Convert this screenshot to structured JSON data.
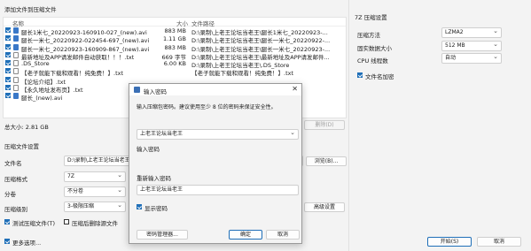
{
  "add_files": {
    "title": "添加文件到压缩文件",
    "columns": {
      "name": "名称",
      "size": "大小",
      "path": "文件路径"
    },
    "files": [
      {
        "name": "腿长1米七_20220923-160910-027_(new).avi",
        "size": "883 MB",
        "path": "D:\\录制\\上老王论坛当老王\\腿长1米七_20220923-...",
        "type": "avi"
      },
      {
        "name": "腿长一米七_20220922-022454-697_(new).avi",
        "size": "1.11 GB",
        "path": "D:\\录制\\上老王论坛当老王\\腿长一米七_20220922-...",
        "type": "avi"
      },
      {
        "name": "腿长一米七_20220923-160909-867_(new).avi",
        "size": "883 MB",
        "path": "D:\\录制\\上老王论坛当老王\\腿长一米七_20220923-...",
        "type": "avi"
      },
      {
        "name": "最新地址及APP请发邮件自动获取！！！.txt",
        "size": "669 字节",
        "path": "D:\\录制\\上老王论坛当老王\\最新地址及APP请发邮件...",
        "type": "txt"
      },
      {
        "name": ".DS_Store",
        "size": "6.00 KB",
        "path": "D:\\录制\\上老王论坛当老王\\.DS_Store",
        "type": "txt"
      },
      {
        "name": "【老子就能下载和观看！纯免费！】.txt",
        "size": "",
        "path": "【老子就能下载和观看！纯免费！】.txt",
        "type": "txt"
      },
      {
        "name": "【论坛介绍】.txt",
        "size": "",
        "path": "",
        "type": "txt"
      },
      {
        "name": "【永久地址发布页】.txt",
        "size": "",
        "path": "",
        "type": "txt"
      },
      {
        "name": "腿长_(new).avi",
        "size": "",
        "path": "",
        "type": "avi"
      }
    ],
    "total_label": "总大小: 2.81 GB",
    "delete_button": "删除(D)"
  },
  "settings": {
    "title": "压缩文件设置",
    "filename_label": "文件名",
    "filename_value": "D:\\录制\\上老王论坛当老王\\上老王论坛当老王.7z",
    "browse_button": "浏览(B)...",
    "format_label": "压缩格式",
    "format_value": "7Z",
    "split_label": "分卷",
    "split_value": "不分卷",
    "level_label": "压缩级别",
    "level_value": "3-极限压缩",
    "advanced_button": "高级设置",
    "test_label": "测试压缩文件(T)",
    "delete_source_label": "压缩后删除源文件",
    "more_label": "更多选项..."
  },
  "right_panel": {
    "title": "7Z 压缩设置",
    "method_label": "压缩方法",
    "method_value": "LZMA2",
    "dict_label": "固实数据大小",
    "dict_value": "512 MB",
    "threads_label": "CPU 线程数",
    "threads_value": "自动",
    "encrypt_names_label": "文件名加密",
    "start_button": "开始(S)",
    "cancel_button": "取消"
  },
  "dialog": {
    "title": "输入密码",
    "message": "输入压缩包密码。建议使用至少 8 位的密码来保证安全性。",
    "password_label": "输入密码",
    "password_value": "上老王论坛当老王",
    "confirm_label": "重新输入密码",
    "confirm_value": "上老王论坛当老王",
    "show_password_label": "显示密码",
    "manager_button": "密码管理器...",
    "ok_button": "确定",
    "cancel_button": "取消"
  }
}
